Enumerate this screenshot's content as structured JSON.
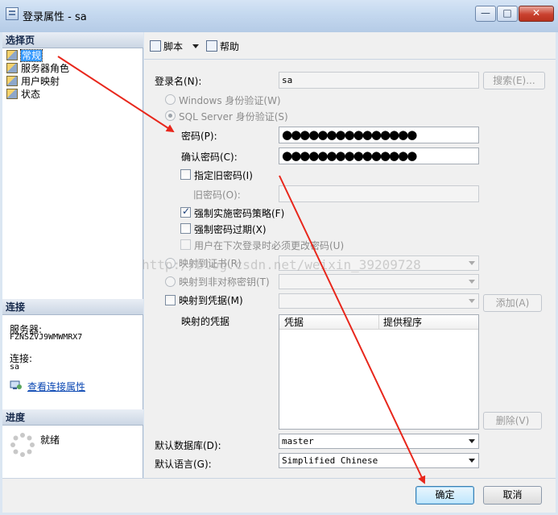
{
  "window": {
    "title": "登录属性 - sa",
    "minimize_glyph": "—",
    "maximize_glyph": "□",
    "close_glyph": "✕"
  },
  "left_pane": {
    "select_page_header": "选择页",
    "pages": [
      {
        "label": "常规",
        "selected": true
      },
      {
        "label": "服务器角色",
        "selected": false
      },
      {
        "label": "用户映射",
        "selected": false
      },
      {
        "label": "状态",
        "selected": false
      }
    ],
    "connection_header": "连接",
    "server_label": "服务器:",
    "server_value": "FZNSZVJ9WMWMRX7",
    "connection_label": "连接:",
    "connection_value": "sa",
    "view_connection_properties": "查看连接属性",
    "progress_header": "进度",
    "progress_status": "就绪"
  },
  "toolbar": {
    "script_label": "脚本",
    "help_label": "帮助"
  },
  "form": {
    "login_name_label": "登录名(N):",
    "login_name_value": "sa",
    "search_button": "搜索(E)...",
    "windows_auth_label": "Windows 身份验证(W)",
    "sql_auth_label": "SQL Server 身份验证(S)",
    "password_label": "密码(P):",
    "password_value": "●●●●●●●●●●●●●●●",
    "confirm_password_label": "确认密码(C):",
    "confirm_password_value": "●●●●●●●●●●●●●●●",
    "specify_old_password_label": "指定旧密码(I)",
    "old_password_label": "旧密码(O):",
    "old_password_value": "",
    "enforce_policy_label": "强制实施密码策略(F)",
    "enforce_policy_checked": true,
    "enforce_expiration_label": "强制密码过期(X)",
    "enforce_expiration_checked": false,
    "must_change_label": "用户在下次登录时必须更改密码(U)",
    "map_to_certificate_label": "映射到证书(R)",
    "map_to_asymmetric_key_label": "映射到非对称密钥(T)",
    "map_to_credential_label": "映射到凭据(M)",
    "add_button": "添加(A)",
    "mapped_credentials_label": "映射的凭据",
    "credentials_columns": [
      "凭据",
      "提供程序"
    ],
    "remove_button": "删除(V)",
    "default_database_label": "默认数据库(D):",
    "default_database_value": "master",
    "default_language_label": "默认语言(G):",
    "default_language_value": "Simplified Chinese"
  },
  "footer": {
    "ok_button": "确定",
    "cancel_button": "取消"
  },
  "watermark": "http://blog.csdn.net/weixin_39209728",
  "colors": {
    "annotation_arrow": "#e8271c",
    "selection": "#3399ff"
  }
}
